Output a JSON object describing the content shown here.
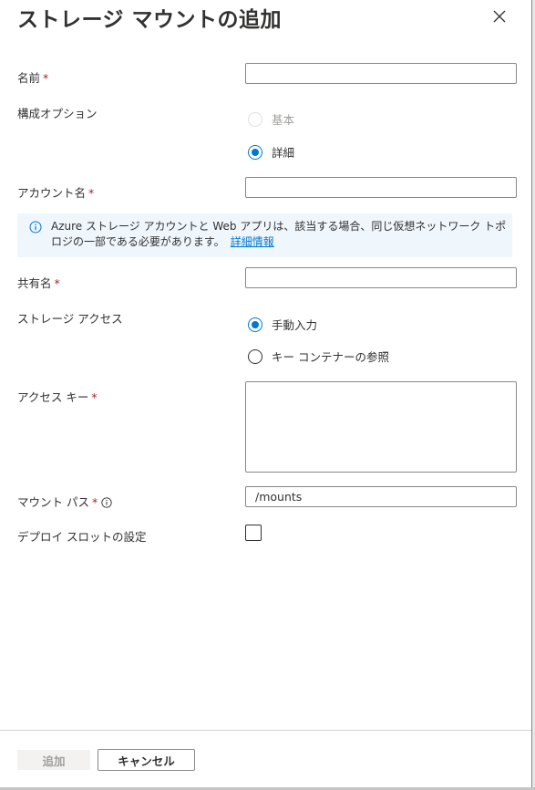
{
  "dialog": {
    "title": "ストレージ マウントの追加"
  },
  "fields": {
    "name_label": "名前",
    "config_label": "構成オプション",
    "config_options": [
      "基本",
      "詳細"
    ],
    "account_label": "アカウント名",
    "share_label": "共有名",
    "access_label": "ストレージ アクセス",
    "access_options": [
      "手動入力",
      "キー コンテナーの参照"
    ],
    "key_label": "アクセス キー",
    "mount_label": "マウント パス",
    "mount_value": "/mounts",
    "slot_label": "デプロイ スロットの設定",
    "required_mark": "*"
  },
  "info": {
    "text": "Azure ストレージ アカウントと Web アプリは、該当する場合、同じ仮想ネットワーク トポロジの一部である必要があります。",
    "link": "詳細情報"
  },
  "footer": {
    "add_label": "追加",
    "cancel_label": "キャンセル"
  },
  "colors": {
    "accent": "#0078d4",
    "required": "#a4262c",
    "info_bg": "#eff6fc"
  }
}
